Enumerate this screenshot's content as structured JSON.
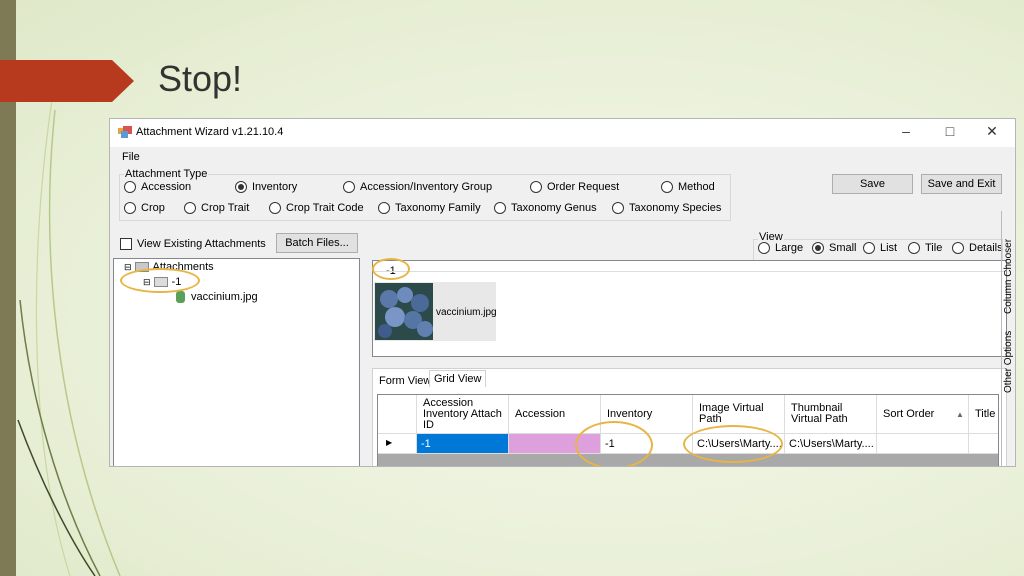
{
  "slide": {
    "title": "Stop!"
  },
  "window": {
    "title": "Attachment Wizard v1.21.10.4",
    "menu_file": "File"
  },
  "attachment_type": {
    "label": "Attachment Type",
    "options": [
      "Accession",
      "Inventory",
      "Accession/Inventory Group",
      "Order Request",
      "Method",
      "Crop",
      "Crop Trait",
      "Crop Trait Code",
      "Taxonomy Family",
      "Taxonomy Genus",
      "Taxonomy Species"
    ],
    "selected": "Inventory"
  },
  "buttons": {
    "save": "Save",
    "save_exit": "Save and Exit",
    "batch": "Batch Files..."
  },
  "view_existing_label": "View Existing Attachments",
  "tree": {
    "root": "Attachments",
    "folder": "-1",
    "file": "vaccinium.jpg"
  },
  "view": {
    "label": "View",
    "options": [
      "Large",
      "Small",
      "List",
      "Tile",
      "Details"
    ],
    "selected": "Small"
  },
  "preview": {
    "folder": "-1",
    "thumb_label": "vaccinium.jpg"
  },
  "tabs": [
    "Form View",
    "Grid View"
  ],
  "grid": {
    "headers": [
      "Accession Inventory Attach ID",
      "Accession",
      "Inventory",
      "Image Virtual Path",
      "Thumbnail Virtual Path",
      "Sort Order",
      "Title"
    ],
    "row": [
      "-1",
      "",
      "-1",
      "C:\\Users\\Marty....",
      "C:\\Users\\Marty....",
      "",
      ""
    ]
  },
  "side_tabs": [
    "Column Chooser",
    "Other Options"
  ],
  "colors": {
    "highlight_ring": "#e8b545",
    "selected_cell": "#0078d7",
    "accession_cell": "#dda0dd",
    "title_arrow": "#b83a1e"
  }
}
